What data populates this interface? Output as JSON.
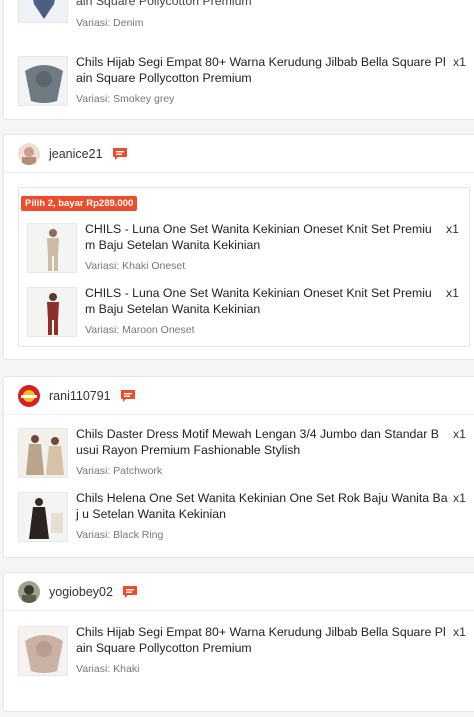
{
  "cards": [
    {
      "items": [
        {
          "name_part": "ain Square Pollycotton Premium",
          "variant": "Variasi: Denim"
        },
        {
          "name": "Chils Hijab Segi Empat 80+ Warna Kerudung Jilbab Bella Square Pl ain Square Pollycotton Premium",
          "qty": "x1",
          "variant": "Variasi: Smokey grey"
        }
      ]
    },
    {
      "username": "jeanice21",
      "bundle_label": "Pilih 2, bayar Rp289.000",
      "items": [
        {
          "name": "CHILS - Luna One Set Wanita Kekinian Oneset Knit Set Premium Baju Setelan Wanita Kekinian",
          "qty": "x1",
          "variant": "Variasi: Khaki Oneset"
        },
        {
          "name": "CHILS - Luna One Set Wanita Kekinian Oneset Knit Set Premium Baju Setelan Wanita Kekinian",
          "qty": "x1",
          "variant": "Variasi: Maroon Oneset"
        }
      ]
    },
    {
      "username": "rani110791",
      "items": [
        {
          "name": "Chils Daster Dress Motif Mewah Lengan 3/4 Jumbo dan Standar B usui Rayon Premium Fashionable Stylish",
          "qty": "x1",
          "variant": "Variasi: Patchwork"
        },
        {
          "name": "Chils Helena One Set Wanita Kekinian One Set Rok Baju Wanita Baj u Setelan Wanita Kekinian",
          "qty": "x1",
          "variant": "Variasi: Black Ring"
        }
      ]
    },
    {
      "username": "yogiobey02",
      "items": [
        {
          "name": "Chils Hijab Segi Empat 80+ Warna Kerudung Jilbab Bella Square Pl ain Square Pollycotton Premium",
          "qty": "x1",
          "variant": "Variasi: Khaki"
        }
      ]
    }
  ],
  "icons": {
    "chat": "chat-bubble-icon"
  },
  "colors": {
    "accent": "#ee4d2d"
  }
}
